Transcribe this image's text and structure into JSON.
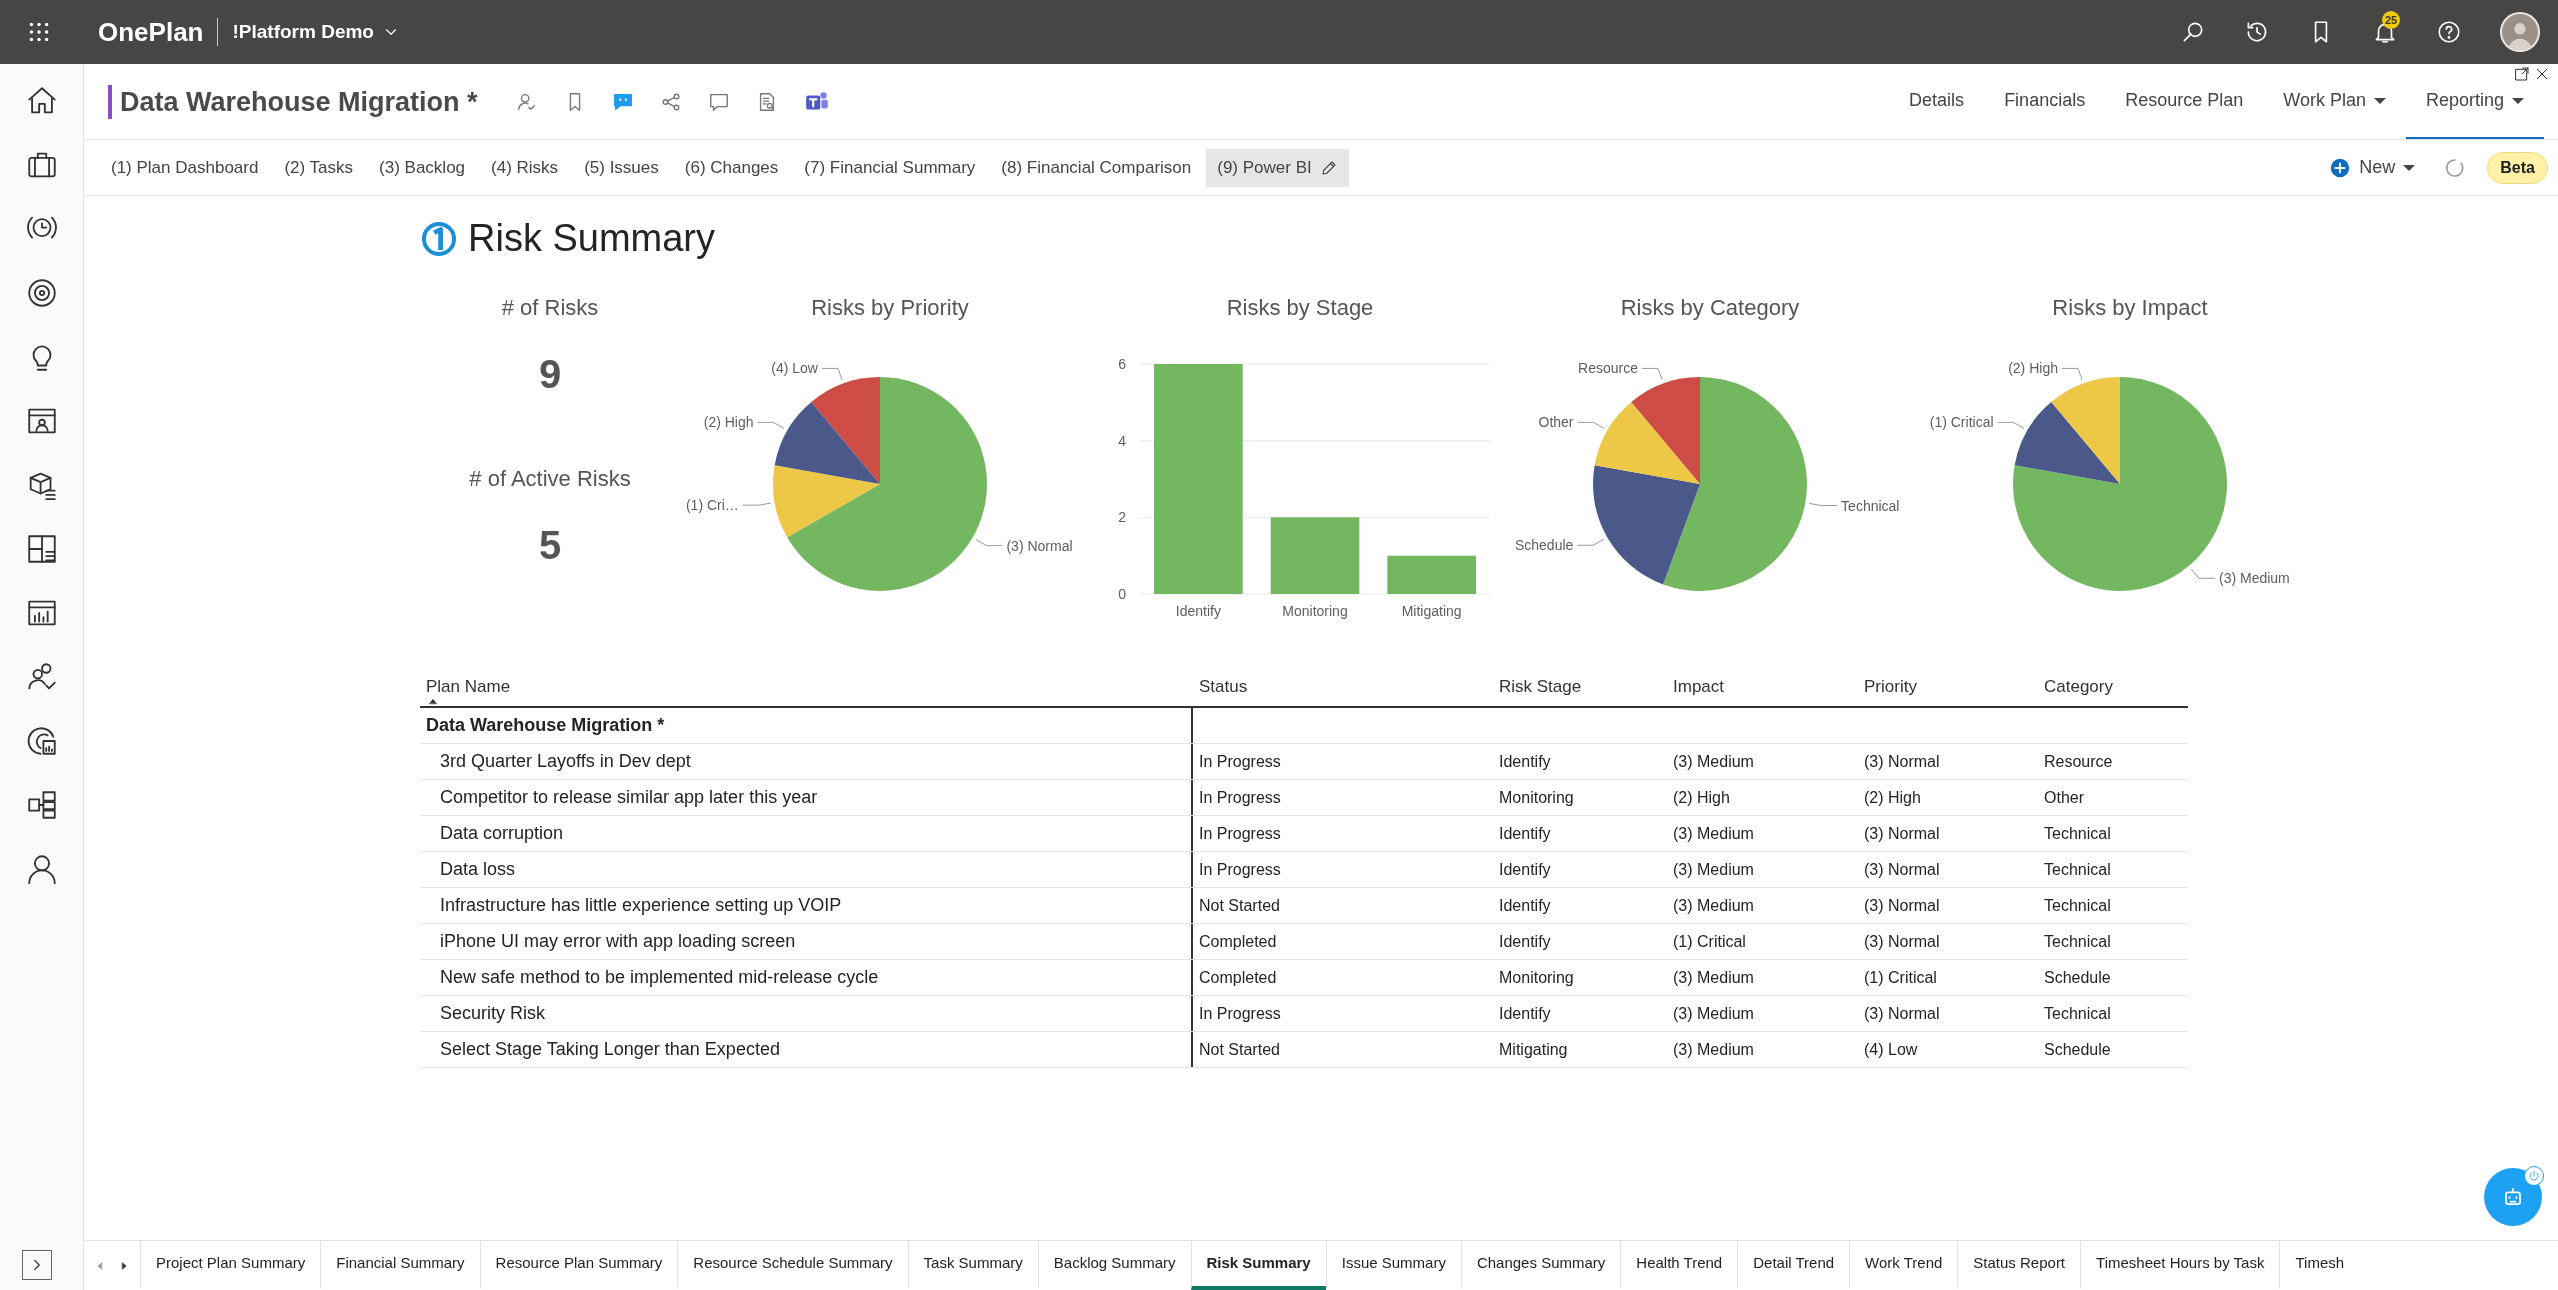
{
  "top_bar": {
    "app_name": "OnePlan",
    "workspace": "!Platform Demo",
    "notification_count": "25"
  },
  "header": {
    "title": "Data Warehouse Migration *",
    "nav": [
      {
        "label": "Details",
        "selected": false,
        "dropdown": false
      },
      {
        "label": "Financials",
        "selected": false,
        "dropdown": false
      },
      {
        "label": "Resource Plan",
        "selected": false,
        "dropdown": false
      },
      {
        "label": "Work Plan",
        "selected": false,
        "dropdown": true
      },
      {
        "label": "Reporting",
        "selected": true,
        "dropdown": true
      }
    ]
  },
  "page_tabs": [
    {
      "label": "(1) Plan Dashboard",
      "selected": false
    },
    {
      "label": "(2) Tasks",
      "selected": false
    },
    {
      "label": "(3) Backlog",
      "selected": false
    },
    {
      "label": "(4) Risks",
      "selected": false
    },
    {
      "label": "(5) Issues",
      "selected": false
    },
    {
      "label": "(6) Changes",
      "selected": false
    },
    {
      "label": "(7) Financial Summary",
      "selected": false
    },
    {
      "label": "(8) Financial Comparison",
      "selected": false
    },
    {
      "label": "(9) Power BI",
      "selected": true
    }
  ],
  "toolbar": {
    "new_label": "New",
    "badge": "Beta"
  },
  "report": {
    "title": "Risk Summary",
    "kpis": [
      {
        "label": "# of Risks",
        "value": "9"
      },
      {
        "label": "# of Active Risks",
        "value": "5"
      }
    ],
    "charts": [
      {
        "chart_data": {
          "type": "pie",
          "title": "Risks by Priority",
          "categories": [
            "(3) Normal",
            "(1) Cri…",
            "(2) High",
            "(4) Low"
          ],
          "values": [
            66.7,
            11.1,
            11.1,
            11.1
          ],
          "colors": [
            "#73b761",
            "#ecc846",
            "#4a588a",
            "#cd4c46"
          ]
        }
      },
      {
        "chart_data": {
          "type": "bar",
          "title": "Risks by Stage",
          "categories": [
            "Identify",
            "Monitoring",
            "Mitigating"
          ],
          "values": [
            6,
            2,
            1
          ],
          "yticks": [
            0,
            2,
            4,
            6
          ],
          "ylim": [
            0,
            6
          ]
        }
      },
      {
        "chart_data": {
          "type": "pie",
          "title": "Risks by Category",
          "categories": [
            "Technical",
            "Schedule",
            "Other",
            "Resource"
          ],
          "values": [
            55.6,
            22.2,
            11.1,
            11.1
          ],
          "colors": [
            "#73b761",
            "#4a588a",
            "#ecc846",
            "#cd4c46"
          ]
        }
      },
      {
        "chart_data": {
          "type": "pie",
          "title": "Risks by Impact",
          "categories": [
            "(3) Medium",
            "(1) Critical",
            "(2) High"
          ],
          "values": [
            77.8,
            11.1,
            11.1
          ],
          "colors": [
            "#73b761",
            "#4a588a",
            "#ecc846"
          ]
        }
      }
    ],
    "table": {
      "columns": [
        {
          "label": "Plan Name",
          "sorted": true
        },
        {
          "label": "Status",
          "sorted": false
        },
        {
          "label": "Risk Stage",
          "sorted": false
        },
        {
          "label": "Impact",
          "sorted": false
        },
        {
          "label": "Priority",
          "sorted": false
        },
        {
          "label": "Category",
          "sorted": false
        }
      ],
      "group": "Data Warehouse Migration *",
      "rows": [
        [
          "3rd Quarter Layoffs in Dev dept",
          "In Progress",
          "Identify",
          "(3) Medium",
          "(3) Normal",
          "Resource"
        ],
        [
          "Competitor to release similar app later this year",
          "In Progress",
          "Monitoring",
          "(2) High",
          "(2) High",
          "Other"
        ],
        [
          "Data corruption",
          "In Progress",
          "Identify",
          "(3) Medium",
          "(3) Normal",
          "Technical"
        ],
        [
          "Data loss",
          "In Progress",
          "Identify",
          "(3) Medium",
          "(3) Normal",
          "Technical"
        ],
        [
          "Infrastructure has little experience setting up VOIP",
          "Not Started",
          "Identify",
          "(3) Medium",
          "(3) Normal",
          "Technical"
        ],
        [
          "iPhone UI may error with app loading screen",
          "Completed",
          "Identify",
          "(1) Critical",
          "(3) Normal",
          "Technical"
        ],
        [
          "New safe method to be implemented mid-release cycle",
          "Completed",
          "Monitoring",
          "(3) Medium",
          "(1) Critical",
          "Schedule"
        ],
        [
          "Security Risk",
          "In Progress",
          "Identify",
          "(3) Medium",
          "(3) Normal",
          "Technical"
        ],
        [
          "Select Stage Taking Longer than Expected",
          "Not Started",
          "Mitigating",
          "(3) Medium",
          "(4) Low",
          "Schedule"
        ]
      ]
    }
  },
  "bottom_tabs": [
    {
      "label": "Project Plan Summary",
      "selected": false
    },
    {
      "label": "Financial Summary",
      "selected": false
    },
    {
      "label": "Resource Plan Summary",
      "selected": false
    },
    {
      "label": "Resource Schedule Summary",
      "selected": false
    },
    {
      "label": "Task Summary",
      "selected": false
    },
    {
      "label": "Backlog Summary",
      "selected": false
    },
    {
      "label": "Risk Summary",
      "selected": true
    },
    {
      "label": "Issue Summary",
      "selected": false
    },
    {
      "label": "Changes Summary",
      "selected": false
    },
    {
      "label": "Health Trend",
      "selected": false
    },
    {
      "label": "Detail Trend",
      "selected": false
    },
    {
      "label": "Work Trend",
      "selected": false
    },
    {
      "label": "Status Report",
      "selected": false
    },
    {
      "label": "Timesheet Hours by Task",
      "selected": false
    },
    {
      "label": "Timesh",
      "selected": false
    }
  ]
}
